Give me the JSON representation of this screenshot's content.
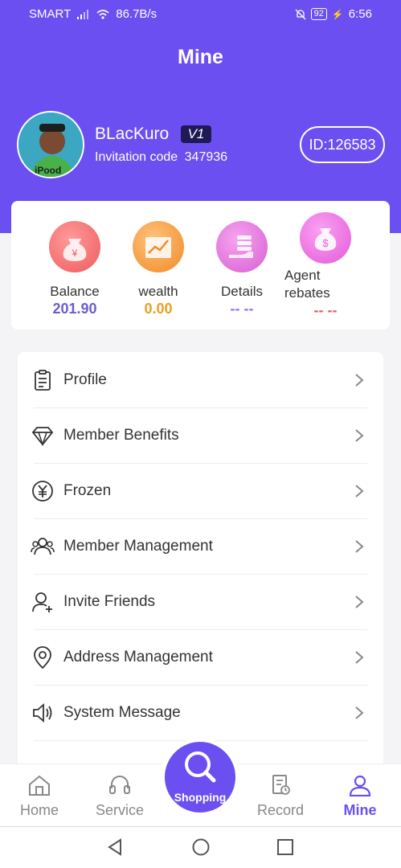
{
  "status_bar": {
    "carrier": "SMART",
    "speed": "86.7B/s",
    "battery": "92",
    "time": "6:56"
  },
  "page_title": "Mine",
  "profile": {
    "username": "BLacKuro",
    "vip": "V1",
    "invitation_label": "Invitation code",
    "invitation_code": "347936",
    "id_label": "ID:126583"
  },
  "stats": [
    {
      "label": "Balance",
      "value": "201.90",
      "icon": "money-bag-icon",
      "value_color": "#6b5ed0"
    },
    {
      "label": "wealth",
      "value": "0.00",
      "icon": "chart-growth-icon",
      "value_color": "#e8a024"
    },
    {
      "label": "Details",
      "value": "-- --",
      "icon": "hand-coins-icon",
      "value_color": "#9b6cf0"
    },
    {
      "label": "Agent rebates",
      "value": "-- --",
      "icon": "dollar-bag-icon",
      "value_color": "#e85a6a"
    }
  ],
  "menu": [
    {
      "label": "Profile",
      "icon": "clipboard-icon"
    },
    {
      "label": "Member Benefits",
      "icon": "diamond-icon"
    },
    {
      "label": "Frozen",
      "icon": "yen-circle-icon"
    },
    {
      "label": "Member Management",
      "icon": "users-icon"
    },
    {
      "label": "Invite Friends",
      "icon": "user-add-icon"
    },
    {
      "label": "Address Management",
      "icon": "location-pin-icon"
    },
    {
      "label": "System Message",
      "icon": "speaker-icon"
    }
  ],
  "nav": {
    "home": "Home",
    "service": "Service",
    "shopping": "Shopping",
    "record": "Record",
    "mine": "Mine"
  },
  "colors": {
    "brand": "#6b4ff1"
  }
}
